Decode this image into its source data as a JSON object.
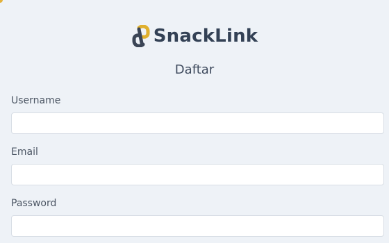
{
  "brand": {
    "name": "SnackLink",
    "icon": "chain-link-icon",
    "icon_colors": {
      "gold": "#e0b02e",
      "slate": "#3b4556"
    }
  },
  "form": {
    "title": "Daftar",
    "fields": [
      {
        "label": "Username",
        "value": "",
        "placeholder": ""
      },
      {
        "label": "Email",
        "value": "",
        "placeholder": ""
      },
      {
        "label": "Password",
        "value": "",
        "placeholder": ""
      }
    ]
  },
  "colors": {
    "background": "#eef2f7",
    "text": "#334155",
    "input_border": "#d7dde5",
    "accent": "#e3b23c"
  }
}
